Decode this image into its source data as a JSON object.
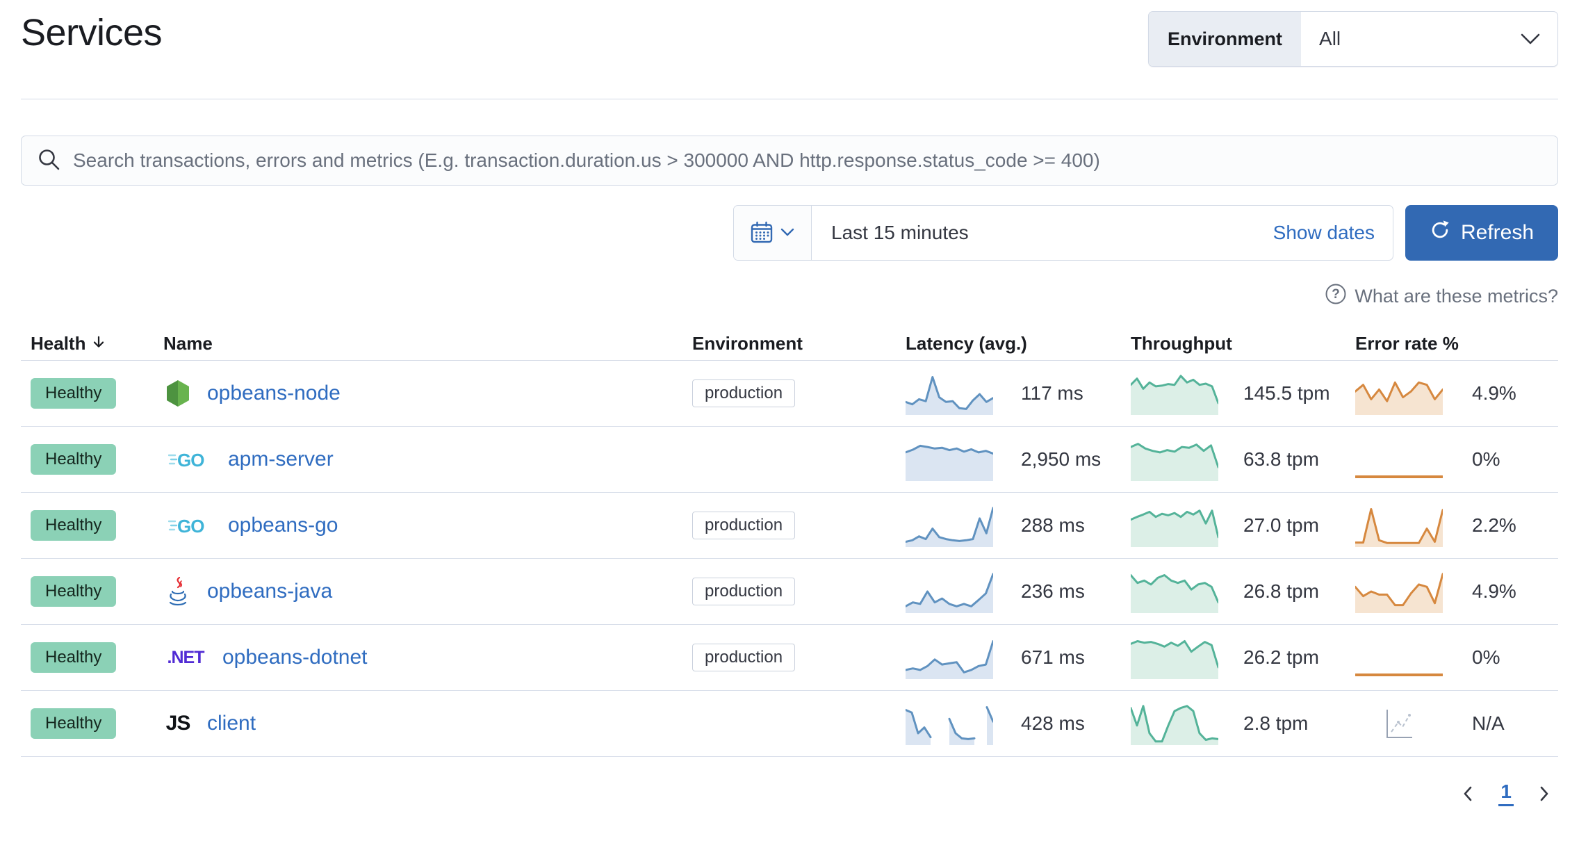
{
  "page": {
    "title": "Services"
  },
  "environment_filter": {
    "label": "Environment",
    "value": "All"
  },
  "search": {
    "placeholder": "Search transactions, errors and metrics (E.g. transaction.duration.us > 300000 AND http.response.status_code >= 400)"
  },
  "datepicker": {
    "duration": "Last 15 minutes",
    "show_dates_label": "Show dates",
    "refresh_label": "Refresh"
  },
  "metrics_help": {
    "label": "What are these metrics?"
  },
  "table": {
    "columns": [
      "Health",
      "Name",
      "Environment",
      "Latency (avg.)",
      "Throughput",
      "Error rate %"
    ],
    "sorted_column": "Health",
    "sort_direction": "desc",
    "rows": [
      {
        "health": "Healthy",
        "agent": "nodejs",
        "name": "opbeans-node",
        "environment": "production",
        "latency": {
          "value": "117 ms",
          "spark": [
            0.28,
            0.22,
            0.35,
            0.3,
            0.92,
            0.4,
            0.28,
            0.3,
            0.12,
            0.1,
            0.32,
            0.48,
            0.28,
            0.38
          ]
        },
        "throughput": {
          "value": "145.5 tpm",
          "spark": [
            0.72,
            0.88,
            0.62,
            0.78,
            0.68,
            0.7,
            0.74,
            0.72,
            0.95,
            0.78,
            0.85,
            0.72,
            0.75,
            0.68,
            0.25
          ]
        },
        "error_rate": {
          "value": "4.9%",
          "spark": [
            0.55,
            0.72,
            0.35,
            0.6,
            0.3,
            0.78,
            0.4,
            0.55,
            0.78,
            0.72,
            0.35,
            0.6
          ]
        }
      },
      {
        "health": "Healthy",
        "agent": "go",
        "name": "apm-server",
        "environment": null,
        "latency": {
          "value": "2,950 ms",
          "spark": [
            0.68,
            0.75,
            0.85,
            0.82,
            0.78,
            0.8,
            0.74,
            0.78,
            0.7,
            0.76,
            0.68,
            0.72,
            0.65
          ]
        },
        "throughput": {
          "value": "63.8 tpm",
          "spark": [
            0.82,
            0.9,
            0.78,
            0.72,
            0.68,
            0.74,
            0.7,
            0.82,
            0.8,
            0.88,
            0.72,
            0.86,
            0.3
          ]
        },
        "error_rate": {
          "value": "0%",
          "spark": "flat"
        }
      },
      {
        "health": "Healthy",
        "agent": "go",
        "name": "opbeans-go",
        "environment": "production",
        "latency": {
          "value": "288 ms",
          "spark": [
            0.08,
            0.12,
            0.22,
            0.15,
            0.42,
            0.2,
            0.15,
            0.12,
            0.1,
            0.12,
            0.15,
            0.68,
            0.3,
            0.95
          ]
        },
        "throughput": {
          "value": "27.0 tpm",
          "spark": [
            0.65,
            0.72,
            0.78,
            0.85,
            0.72,
            0.8,
            0.76,
            0.82,
            0.72,
            0.85,
            0.78,
            0.88,
            0.55,
            0.88,
            0.2
          ]
        },
        "error_rate": {
          "value": "2.2%",
          "spark": [
            0.06,
            0.06,
            0.92,
            0.12,
            0.05,
            0.05,
            0.05,
            0.05,
            0.05,
            0.42,
            0.08,
            0.9
          ]
        }
      },
      {
        "health": "Healthy",
        "agent": "java",
        "name": "opbeans-java",
        "environment": "production",
        "latency": {
          "value": "236 ms",
          "spark": [
            0.12,
            0.22,
            0.18,
            0.5,
            0.22,
            0.32,
            0.18,
            0.12,
            0.18,
            0.12,
            0.28,
            0.45,
            0.95
          ]
        },
        "throughput": {
          "value": "26.8 tpm",
          "spark": [
            0.92,
            0.72,
            0.78,
            0.68,
            0.85,
            0.92,
            0.78,
            0.72,
            0.78,
            0.55,
            0.68,
            0.72,
            0.62,
            0.22
          ]
        },
        "error_rate": {
          "value": "4.9%",
          "spark": [
            0.62,
            0.38,
            0.5,
            0.42,
            0.42,
            0.15,
            0.15,
            0.45,
            0.68,
            0.62,
            0.2,
            0.95
          ]
        }
      },
      {
        "health": "Healthy",
        "agent": "dotnet",
        "name": "opbeans-dotnet",
        "environment": "production",
        "latency": {
          "value": "671 ms",
          "spark": [
            0.18,
            0.22,
            0.18,
            0.28,
            0.45,
            0.32,
            0.35,
            0.38,
            0.12,
            0.18,
            0.28,
            0.32,
            0.92
          ]
        },
        "throughput": {
          "value": "26.2 tpm",
          "spark": [
            0.85,
            0.92,
            0.88,
            0.9,
            0.85,
            0.78,
            0.88,
            0.8,
            0.92,
            0.65,
            0.78,
            0.9,
            0.82,
            0.25
          ]
        },
        "error_rate": {
          "value": "0%",
          "spark": "flat"
        }
      },
      {
        "health": "Healthy",
        "agent": "js",
        "name": "client",
        "environment": null,
        "latency": {
          "value": "428 ms",
          "spark": [
            0.85,
            0.78,
            0.25,
            0.4,
            0.15,
            null,
            null,
            0.62,
            0.25,
            0.12,
            0.1,
            0.12,
            null,
            0.92,
            0.55
          ]
        },
        "throughput": {
          "value": "2.8 tpm",
          "spark": [
            0.9,
            0.45,
            0.95,
            0.25,
            0.04,
            0.04,
            0.45,
            0.82,
            0.9,
            0.95,
            0.82,
            0.25,
            0.08,
            0.12,
            0.1
          ]
        },
        "error_rate": {
          "value": "N/A",
          "spark": "na"
        }
      }
    ]
  },
  "pagination": {
    "current_page": "1"
  },
  "colors": {
    "accent_button": "#3269b3",
    "link": "#2f6cc0",
    "healthy_badge": "#8bd1b6",
    "latency_line": "#6092c0",
    "latency_fill": "#dbe5f2",
    "throughput_line": "#54b399",
    "throughput_fill": "#dcefe7",
    "error_line": "#d6883f",
    "error_fill": "#f6e4d1",
    "border": "#d3dae6"
  }
}
